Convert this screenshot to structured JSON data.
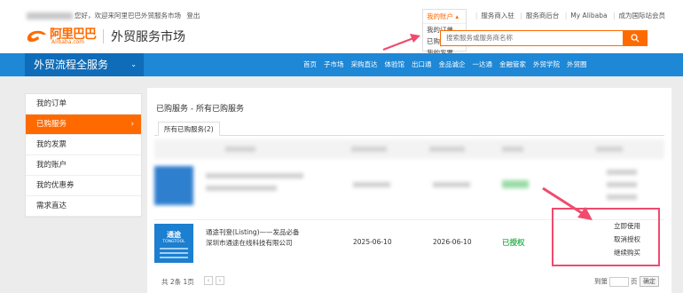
{
  "header": {
    "greeting": "您好，欢迎来阿里巴巴外贸服务市场",
    "logout": "登出",
    "account_menu": {
      "title": "我的账户",
      "items": [
        "我的订单",
        "已购服务",
        "我的发票"
      ]
    },
    "links": [
      "服务商入驻",
      "服务商后台",
      "My Alibaba",
      "成为国际站会员"
    ],
    "logo_cn": "阿里巴巴",
    "logo_en": "Alibaba.com",
    "site_title": "外贸服务市场",
    "search_placeholder": "搜索服务或服务商名称"
  },
  "nav": {
    "category": "外贸流程全服务",
    "items": [
      "首页",
      "子市场",
      "采购直达",
      "体验馆",
      "出口通",
      "金品诚企",
      "一达通",
      "金融管家",
      "外贸学院",
      "外贸圈"
    ]
  },
  "sidebar": {
    "items": [
      {
        "label": "我的订单",
        "active": false
      },
      {
        "label": "已购服务",
        "active": true
      },
      {
        "label": "我的发票",
        "active": false
      },
      {
        "label": "我的账户",
        "active": false
      },
      {
        "label": "我的优惠券",
        "active": false
      },
      {
        "label": "需求直达",
        "active": false
      }
    ]
  },
  "main": {
    "title": "已购服务 - 所有已购服务",
    "tab": "所有已购服务(2)",
    "row2": {
      "thumb_title": "通途",
      "thumb_brand": "TONGTOOL",
      "name": "通途刊登(Listing)——发品必备",
      "company": "深圳市通途在线科技有限公司",
      "start": "2025-06-10",
      "end": "2026-06-10",
      "status": "已授权",
      "ops": [
        "立即使用",
        "取消授权",
        "继续购买"
      ]
    },
    "pager": {
      "info": "共 2条 1页",
      "prev": "‹",
      "next": "›",
      "goto_prefix": "到第",
      "goto_suffix": "页",
      "confirm": "确定"
    }
  },
  "colors": {
    "accent": "#ff6a00",
    "nav": "#1e87d6",
    "status": "#3bb35a",
    "annotation": "#f04b6e"
  }
}
